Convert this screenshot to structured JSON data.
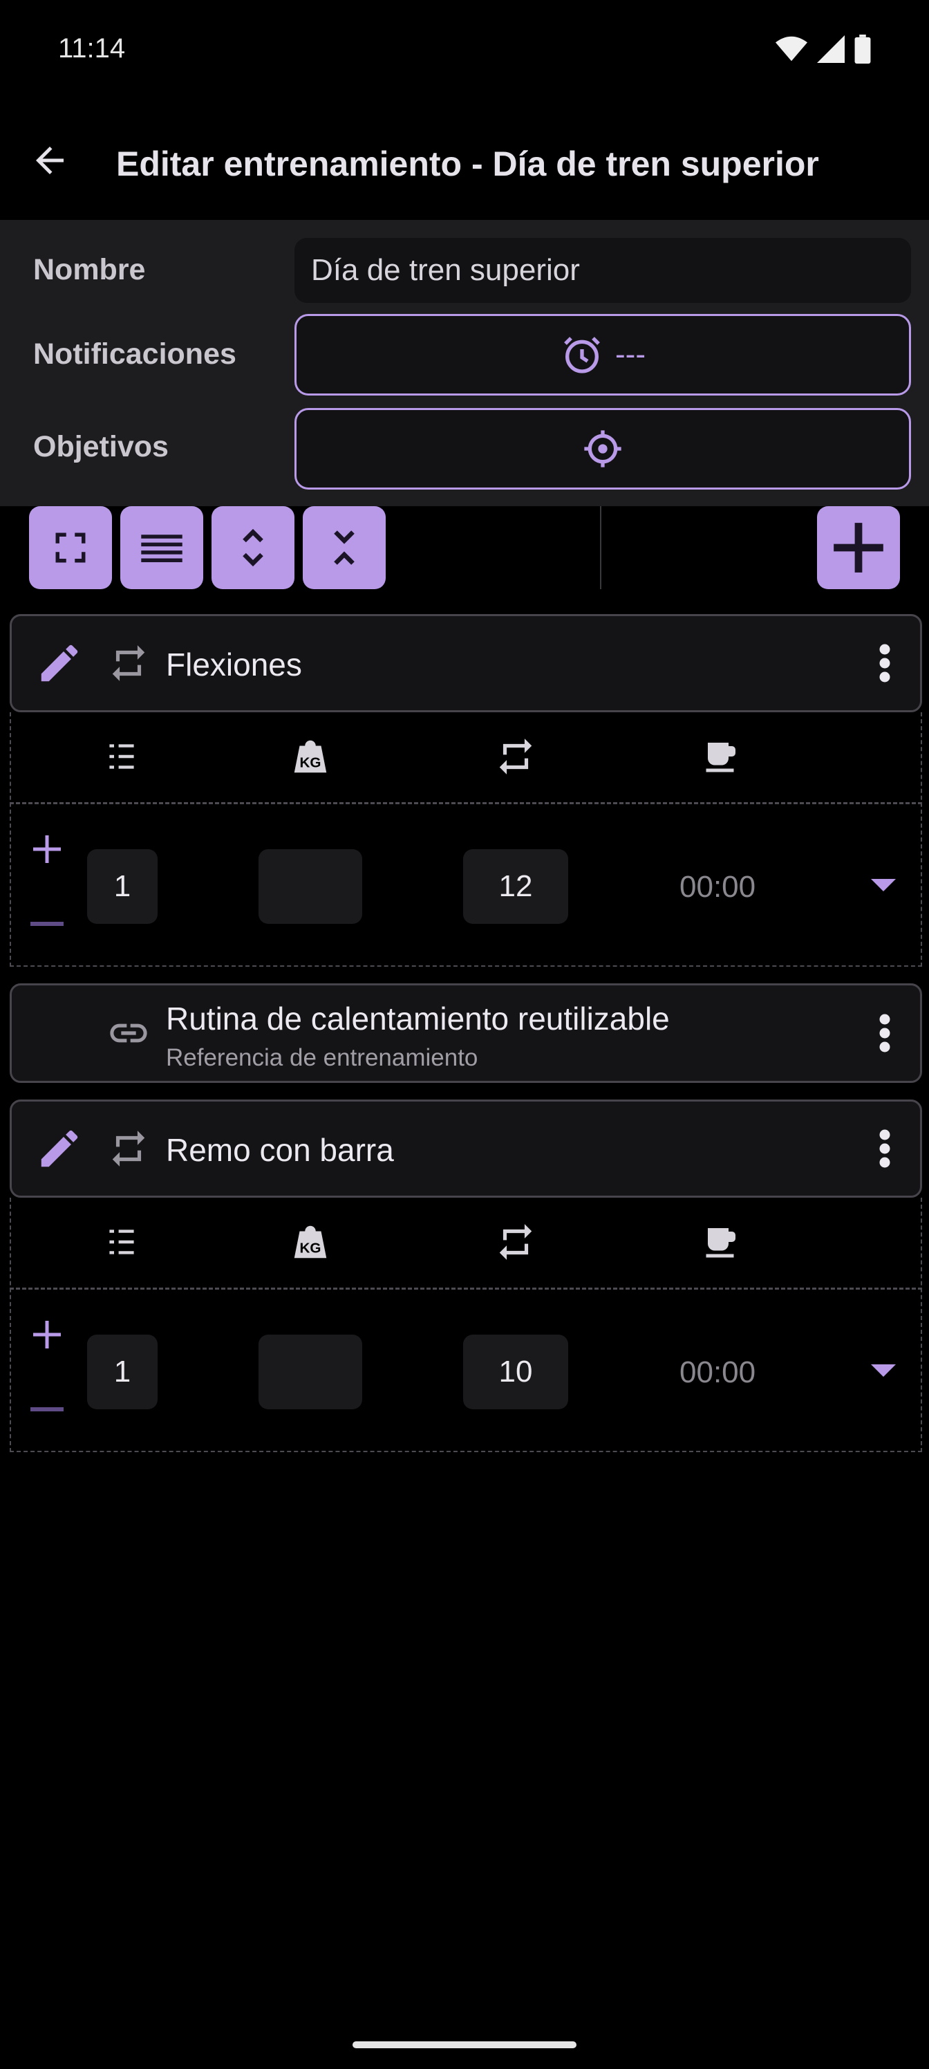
{
  "status_bar": {
    "time": "11:14"
  },
  "top_bar": {
    "title": "Editar entrenamiento - Día de tren superior"
  },
  "form": {
    "name_label": "Nombre",
    "name_value": "Día de tren superior",
    "notifications_label": "Notificaciones",
    "notifications_value": "---",
    "goals_label": "Objetivos"
  },
  "exercises": [
    {
      "title": "Flexiones",
      "sets": "1",
      "weight": "",
      "reps": "12",
      "rest": "00:00"
    },
    {
      "title": "Rutina de calentamiento reutilizable",
      "subtitle": "Referencia de entrenamiento"
    },
    {
      "title": "Remo con barra",
      "sets": "1",
      "weight": "",
      "reps": "10",
      "rest": "00:00"
    }
  ],
  "colors": {
    "accent": "#b89ae8",
    "background": "#000000",
    "panel": "#1d1c1f"
  }
}
